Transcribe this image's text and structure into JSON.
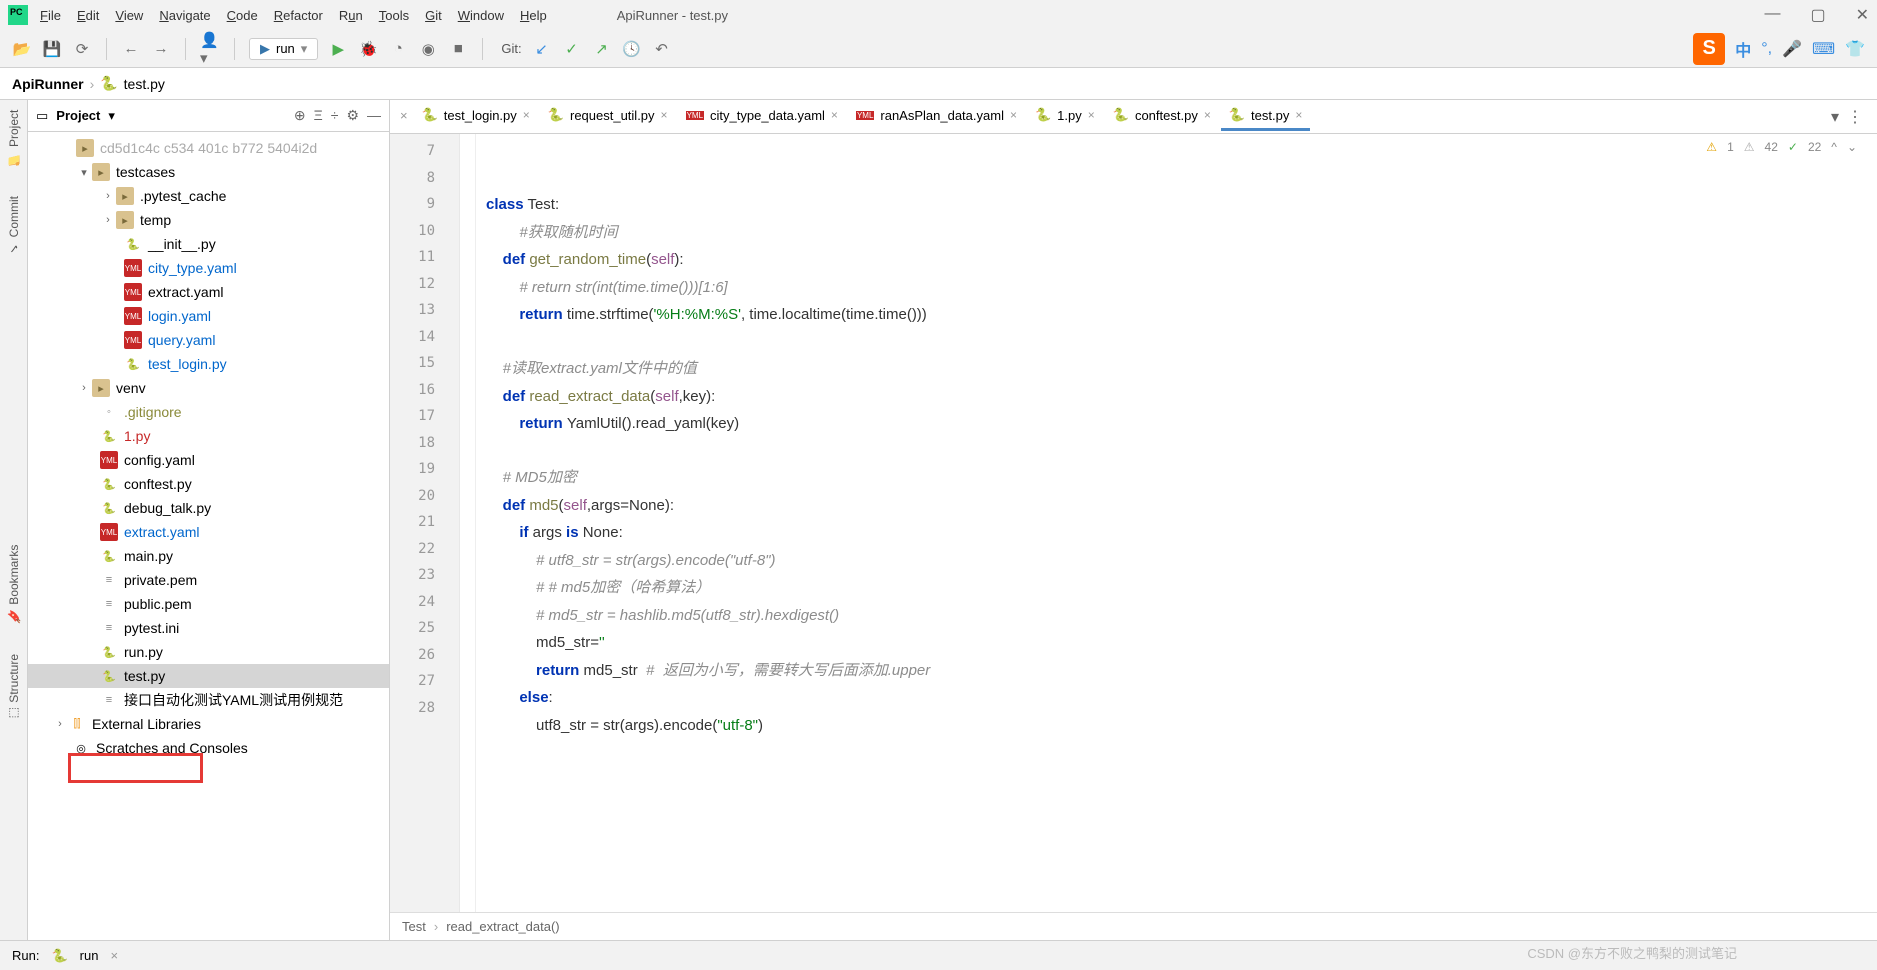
{
  "window": {
    "title": "ApiRunner - test.py"
  },
  "menu": [
    "File",
    "Edit",
    "View",
    "Navigate",
    "Code",
    "Refactor",
    "Run",
    "Tools",
    "Git",
    "Window",
    "Help"
  ],
  "runConfig": "run",
  "gitLabel": "Git:",
  "breadcrumb": {
    "p1": "ApiRunner",
    "p2": "test.py"
  },
  "sidebars": {
    "project": "Project",
    "commit": "Commit",
    "bookmarks": "Bookmarks",
    "structure": "Structure"
  },
  "projectPanel": {
    "title": "Project"
  },
  "tree": {
    "truncated": "cd5d1c4c c534 401c b772 5404i2d",
    "testcases": "testcases",
    "pytest_cache": ".pytest_cache",
    "temp": "temp",
    "init": "__init__.py",
    "city_type": "city_type.yaml",
    "extract": "extract.yaml",
    "login": "login.yaml",
    "query": "query.yaml",
    "test_login": "test_login.py",
    "venv": "venv",
    "gitignore": ".gitignore",
    "onepy": "1.py",
    "config": "config.yaml",
    "conftest": "conftest.py",
    "debug_talk": "debug_talk.py",
    "extract2": "extract.yaml",
    "main": "main.py",
    "private": "private.pem",
    "public": "public.pem",
    "pytestini": "pytest.ini",
    "runpy": "run.py",
    "testpy": "test.py",
    "chinese": "接口自动化测试YAML测试用例规范",
    "external": "External Libraries",
    "scratches": "Scratches and Consoles"
  },
  "tabs": [
    {
      "label": "test_login.py",
      "icon": "py"
    },
    {
      "label": "request_util.py",
      "icon": "py"
    },
    {
      "label": "city_type_data.yaml",
      "icon": "yaml"
    },
    {
      "label": "ranAsPlan_data.yaml",
      "icon": "yaml"
    },
    {
      "label": "1.py",
      "icon": "py"
    },
    {
      "label": "conftest.py",
      "icon": "py"
    },
    {
      "label": "test.py",
      "icon": "py",
      "active": true
    }
  ],
  "inspections": {
    "warn": "1",
    "weak": "42",
    "ok": "22"
  },
  "lines": {
    "start": 7,
    "end": 28
  },
  "code": {
    "l9a": "class",
    "l9b": " Test:",
    "l10": "        #获取随机时间",
    "l11a": "    def ",
    "l11b": "get_random_time",
    "l11c": "(",
    "l11d": "self",
    "l11e": "):",
    "l12": "        # return str(int(time.time()))[1:6]",
    "l13a": "        return ",
    "l13b": "time.strftime(",
    "l13c": "'%H:%M:%S'",
    "l13d": ", time.localtime(time.time()))",
    "l15": "    #读取extract.yaml文件中的值",
    "l16a": "    def ",
    "l16b": "read_extract_data",
    "l16c": "(",
    "l16d": "self",
    "l16e": ",key):",
    "l17a": "        return ",
    "l17b": "YamlUtil().read_yaml(key)",
    "l19": "    # MD5加密",
    "l20a": "    def ",
    "l20b": "md5",
    "l20c": "(",
    "l20d": "self",
    "l20e": ",args=None):",
    "l21a": "        if ",
    "l21b": "args ",
    "l21c": "is ",
    "l21d": "None:",
    "l22": "            # utf8_str = str(args).encode(\"utf-8\")",
    "l23": "            # # md5加密（哈希算法）",
    "l24": "            # md5_str = hashlib.md5(utf8_str).hexdigest()",
    "l25a": "            md5_str=",
    "l25b": "''",
    "l26a": "            return ",
    "l26b": "md5_str  ",
    "l26c": "#  返回为小写，需要转大写后面添加.upper",
    "l27a": "        else",
    "l27b": ":",
    "l28a": "            utf8_str = str(args).encode(",
    "l28b": "\"utf-8\"",
    "l28c": ")"
  },
  "editorCrumb": {
    "c1": "Test",
    "c2": "read_extract_data()"
  },
  "bottom": {
    "run": "Run:",
    "config": "run"
  },
  "watermark": "CSDN @东方不败之鸭梨的测试笔记"
}
